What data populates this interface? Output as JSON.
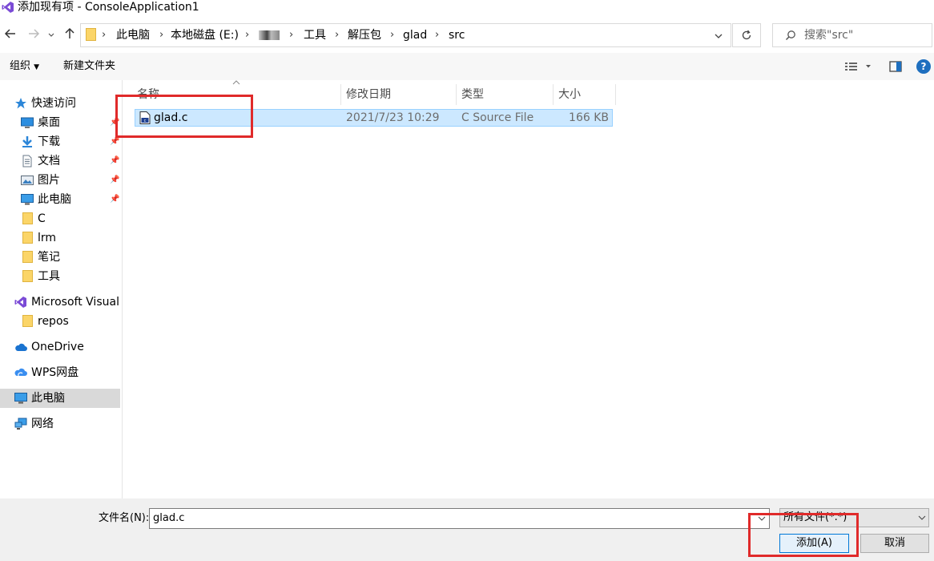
{
  "window": {
    "title": "添加现有项 - ConsoleApplication1"
  },
  "navigation": {
    "back_icon": "arrow-left-icon",
    "forward_icon": "arrow-right-icon",
    "recent_icon": "chevron-down-icon",
    "up_icon": "arrow-up-icon",
    "breadcrumbs": [
      "此电脑",
      "本地磁盘 (E:)",
      "",
      "工具",
      "解压包",
      "glad",
      "src"
    ],
    "search_placeholder": "搜索\"src\""
  },
  "toolbar": {
    "organize_label": "组织",
    "new_folder_label": "新建文件夹"
  },
  "sidebar": {
    "items": [
      {
        "label": "快速访问",
        "icon": "star-icon"
      },
      {
        "label": "桌面",
        "icon": "desktop-icon",
        "pinned": true
      },
      {
        "label": "下载",
        "icon": "download-icon",
        "pinned": true
      },
      {
        "label": "文档",
        "icon": "document-icon",
        "pinned": true
      },
      {
        "label": "图片",
        "icon": "picture-icon",
        "pinned": true
      },
      {
        "label": "此电脑",
        "icon": "computer-icon",
        "pinned": true
      },
      {
        "label": "C",
        "icon": "folder-icon"
      },
      {
        "label": "lrm",
        "icon": "folder-icon"
      },
      {
        "label": "笔记",
        "icon": "folder-icon"
      },
      {
        "label": "工具",
        "icon": "folder-icon"
      },
      {
        "label": "Microsoft Visual",
        "icon": "visual-studio-icon"
      },
      {
        "label": "repos",
        "icon": "folder-icon"
      },
      {
        "label": "OneDrive",
        "icon": "cloud-icon"
      },
      {
        "label": "WPS网盘",
        "icon": "cloud-icon"
      },
      {
        "label": "此电脑",
        "icon": "computer-icon",
        "selected": true
      },
      {
        "label": "网络",
        "icon": "network-icon"
      }
    ]
  },
  "file_list": {
    "columns": [
      "名称",
      "修改日期",
      "类型",
      "大小"
    ],
    "rows": [
      {
        "name": "glad.c",
        "modified": "2021/7/23 10:29",
        "type": "C Source File",
        "size": "166 KB",
        "icon": "c-source-file-icon"
      }
    ]
  },
  "bottom": {
    "filename_label": "文件名(N):",
    "filename_value": "glad.c",
    "filter_value": "所有文件(*.*)",
    "add_label": "添加(A)",
    "cancel_label": "取消"
  },
  "colors": {
    "accent_red": "#e02a2a",
    "selection_bg": "#cce8ff",
    "selection_border": "#99d1ff"
  }
}
